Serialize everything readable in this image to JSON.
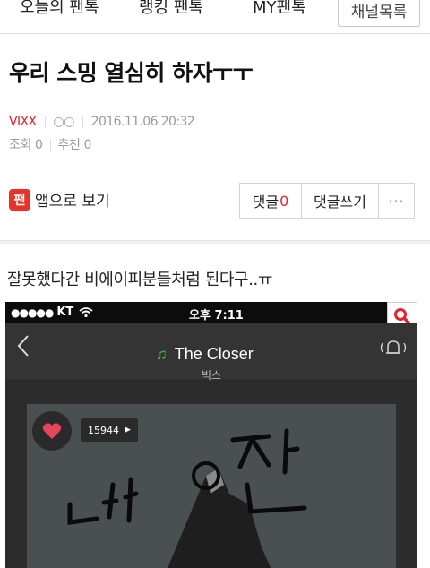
{
  "nav": {
    "tabs": [
      "오늘의 팬톡",
      "랭킹 팬톡",
      "MY팬톡"
    ],
    "channel_button": "채널목록"
  },
  "post": {
    "title": "우리 스밍 열심히 하자ㅜㅜ",
    "channel": "VIXX",
    "author": "○○",
    "date": "2016.11.06 20:32",
    "views": "조회 0",
    "recommends": "추천 0",
    "body": "잘못했다간 비에이피분들처럼 된다구..ㅠ"
  },
  "app_link": {
    "icon_text": "팬",
    "label": "앱으로 보기"
  },
  "comment_bar": {
    "comment_label": "댓글",
    "comment_count": "0",
    "write_label": "댓글쓰기",
    "more_label": "···"
  },
  "screenshot": {
    "carrier": "KT",
    "signal_dots": "●●●●●",
    "time": "오후 7:11",
    "song": "The Closer",
    "artist": "빅스",
    "like_count": "15944",
    "handwriting": "내이판",
    "accent": "#4cc24c",
    "search_icon_color": "#e8212e"
  },
  "colors": {
    "accent_red": "#e8212e",
    "app_icon": "#e8332a"
  }
}
